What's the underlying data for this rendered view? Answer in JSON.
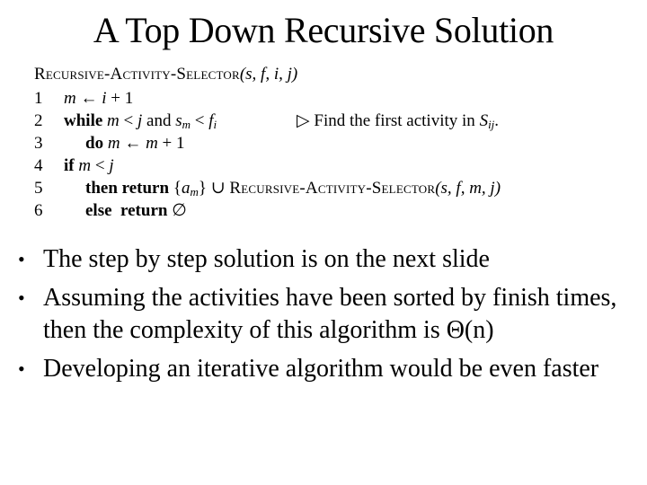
{
  "slide": {
    "title": "A Top Down Recursive Solution"
  },
  "pseudocode": {
    "procedure_name": "Recursive-Activity-Selector",
    "params": "(s, f, i, j)",
    "lines": [
      {
        "num": "1",
        "var": "m",
        "arrow": " ← ",
        "expr": "i",
        "tail": " + 1"
      },
      {
        "num": "2",
        "kw": "while",
        "text_a": "m",
        "text_b": " < ",
        "text_c": "j",
        "and": " and ",
        "s": "s",
        "s_sub": "m",
        "lt": " < ",
        "f": "f",
        "f_sub": "i",
        "comment_marker": "▷",
        "comment": " Find the first activity in ",
        "comment_var": "S",
        "comment_sub": "ij",
        "comment_end": "."
      },
      {
        "num": "3",
        "kw": "do",
        "var": "m",
        "arrow": " ← ",
        "expr": "m",
        "tail": " + 1"
      },
      {
        "num": "4",
        "kw": "if",
        "var": "m",
        "lt": " < ",
        "expr": "j"
      },
      {
        "num": "5",
        "kw": "then return",
        "set_open": " {",
        "a": "a",
        "a_sub": "m",
        "set_close": "} ∪ ",
        "call": "Recursive-Activity-Selector",
        "call_params": "(s, f, m, j)"
      },
      {
        "num": "6",
        "kw": "else  return",
        "empty": " ∅"
      }
    ]
  },
  "bullets": [
    {
      "text": "The step by step solution is on the next slide"
    },
    {
      "text": "Assuming the activities have been sorted by finish times, then the complexity of this algorithm is Θ(n)"
    },
    {
      "text": "Developing an iterative algorithm would be even faster"
    }
  ],
  "bullet_char": "•"
}
